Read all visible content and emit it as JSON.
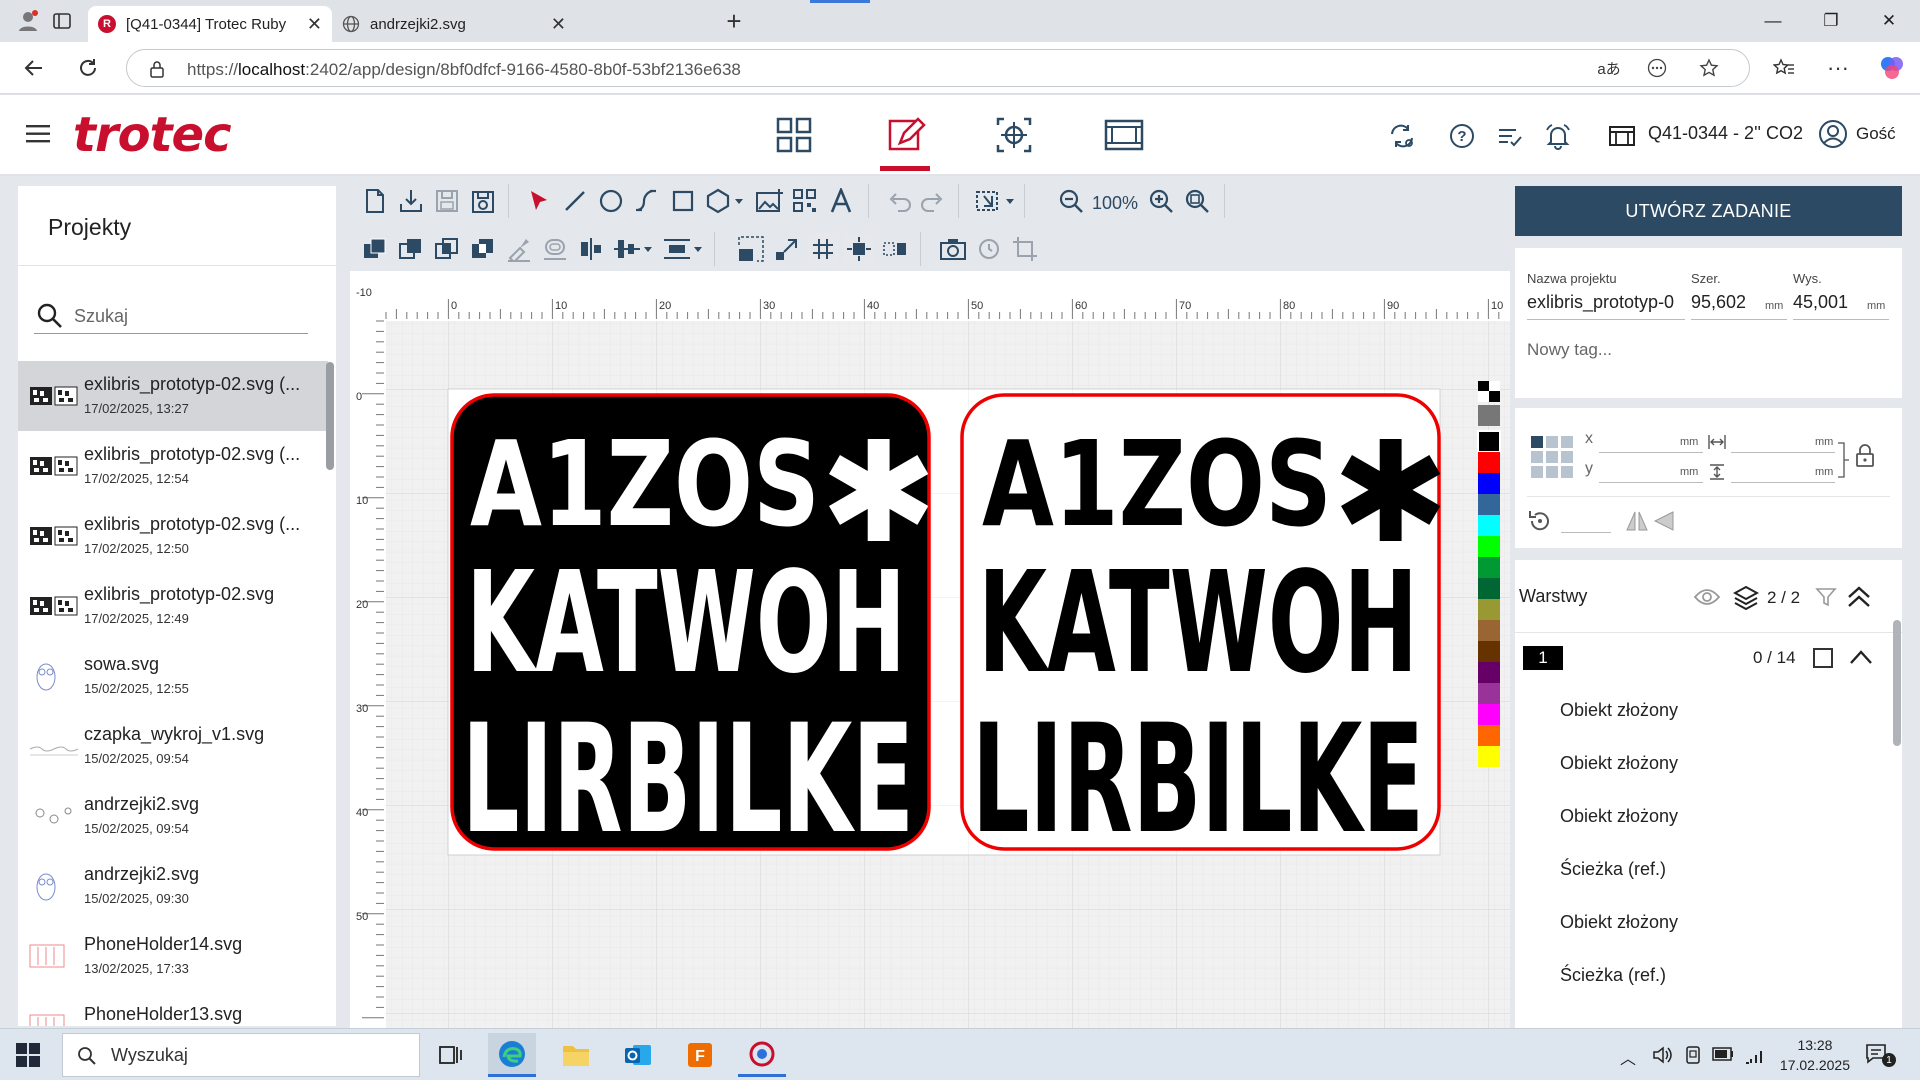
{
  "browser": {
    "tabs": [
      {
        "title": "[Q41-0344] Trotec Ruby",
        "active": true
      },
      {
        "title": "andrzejki2.svg",
        "active": false
      }
    ],
    "url_prefix": "https://",
    "url_host": "localhost",
    "url_rest": ":2402/app/design/8bf0dfcf-9166-4580-8b0f-53bf2136e638"
  },
  "app": {
    "logo": "trotec",
    "device": "Q41-0344 - 2'' CO2",
    "user": "Gość",
    "accent": "#c8102e"
  },
  "projects": {
    "title": "Projekty",
    "search_placeholder": "Szukaj",
    "items": [
      {
        "name": "exlibris_prototyp-02.svg (...",
        "date": "17/02/2025, 13:27"
      },
      {
        "name": "exlibris_prototyp-02.svg (...",
        "date": "17/02/2025, 12:54"
      },
      {
        "name": "exlibris_prototyp-02.svg (...",
        "date": "17/02/2025, 12:50"
      },
      {
        "name": "exlibris_prototyp-02.svg",
        "date": "17/02/2025, 12:49"
      },
      {
        "name": "sowa.svg",
        "date": "15/02/2025, 12:55"
      },
      {
        "name": "czapka_wykroj_v1.svg",
        "date": "15/02/2025, 09:54"
      },
      {
        "name": "andrzejki2.svg",
        "date": "15/02/2025, 09:54"
      },
      {
        "name": "andrzejki2.svg",
        "date": "15/02/2025, 09:30"
      },
      {
        "name": "PhoneHolder14.svg",
        "date": "13/02/2025, 17:33"
      },
      {
        "name": "PhoneHolder13.svg",
        "date": ""
      }
    ]
  },
  "toolbar": {
    "zoom": "100%"
  },
  "ruler": {
    "h": [
      "0",
      "10",
      "20",
      "30",
      "40",
      "50",
      "60",
      "70",
      "80",
      "90",
      "10"
    ],
    "v": [
      "-10",
      "0",
      "10",
      "20",
      "30",
      "40",
      "50"
    ]
  },
  "design": {
    "line1": "A1ZOS",
    "star": "✱",
    "line2": "KATWOH",
    "line3": "LIRBILKE"
  },
  "palette": [
    "#000000",
    "#ff0000",
    "#0000ff",
    "#336699",
    "#00ffff",
    "#00ff00",
    "#009933",
    "#006633",
    "#999933",
    "#996633",
    "#663300",
    "#660066",
    "#993399",
    "#ff00ff",
    "#ff6600",
    "#ffff00"
  ],
  "right": {
    "create_button": "UTWÓRZ ZADANIE",
    "project_name_label": "Nazwa projektu",
    "project_name": "exlibris_prototyp-0",
    "width_label": "Szer.",
    "width": "95,602",
    "height_label": "Wys.",
    "height": "45,001",
    "unit": "mm",
    "tag_placeholder": "Nowy tag...",
    "x_label": "x",
    "y_label": "y",
    "layers_title": "Warstwy",
    "layers_count": "2 / 2",
    "layer_number": "1",
    "layer_objects": "0 / 14",
    "layer_items": [
      "Obiekt złożony",
      "Obiekt złożony",
      "Obiekt złożony",
      "Ścieżka (ref.)",
      "Obiekt złożony",
      "Ścieżka (ref.)"
    ]
  },
  "taskbar": {
    "search_placeholder": "Wyszukaj",
    "time": "13:28",
    "date": "17.02.2025",
    "notif": "1"
  }
}
